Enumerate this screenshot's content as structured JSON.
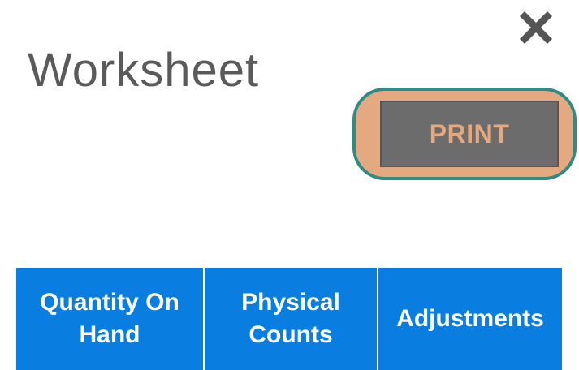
{
  "dialog": {
    "title": "Worksheet",
    "close_icon": "close-x-icon"
  },
  "toolbar": {
    "print_label": "PRINT"
  },
  "table": {
    "columns": [
      {
        "label": "Quantity On Hand"
      },
      {
        "label": "Physical Counts"
      },
      {
        "label": "Adjustments"
      }
    ]
  },
  "colors": {
    "header_blue": "#0a7ee0",
    "print_button_bg": "#6c6c6c",
    "print_text": "#e4a980",
    "highlight_fill": "#e4a980",
    "highlight_border": "#2e8b86",
    "title_text": "#5a5a5a"
  }
}
